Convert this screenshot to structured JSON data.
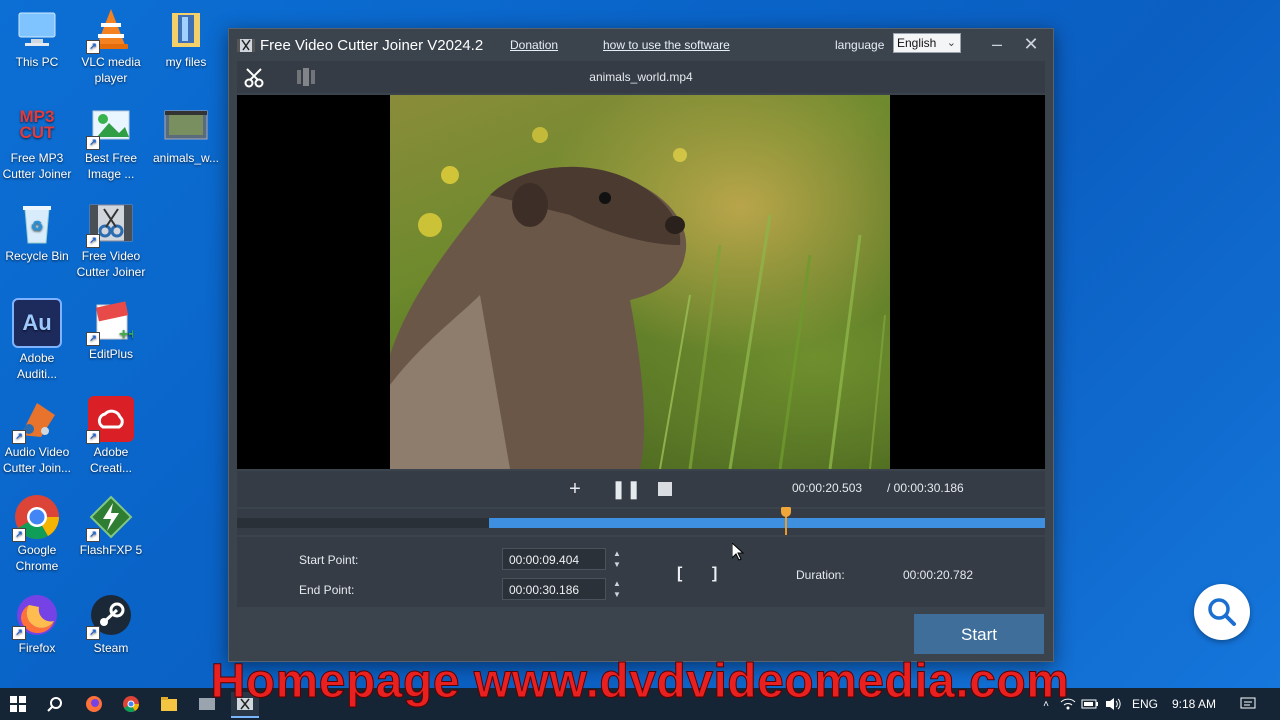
{
  "desktop": {
    "icons": [
      {
        "label": "This PC"
      },
      {
        "label": "VLC media player"
      },
      {
        "label": "my files"
      },
      {
        "label": "Free MP3 Cutter Joiner",
        "glyph": "MP3 CUT"
      },
      {
        "label": "Best Free Image ..."
      },
      {
        "label": "animals_w..."
      },
      {
        "label": "Recycle Bin"
      },
      {
        "label": "Free Video Cutter Joiner"
      },
      {
        "label": "Adobe Auditi...",
        "glyph": "Au"
      },
      {
        "label": "EditPlus"
      },
      {
        "label": "Audio Video Cutter Join..."
      },
      {
        "label": "Adobe Creati..."
      },
      {
        "label": "Google Chrome"
      },
      {
        "label": "FlashFXP 5"
      },
      {
        "label": "Firefox"
      },
      {
        "label": "Steam"
      }
    ]
  },
  "window": {
    "title": "Free Video Cutter Joiner V2024.2",
    "donation_link": "Donation",
    "howto_link": "how to use the software",
    "language_label": "language",
    "language_value": "English",
    "filename": "animals_world.mp4",
    "current_time": "00:00:20.503",
    "total_time": "/ 00:00:30.186",
    "start_point_label": "Start Point:",
    "start_point_value": "00:00:09.404",
    "end_point_label": "End Point:",
    "end_point_value": "00:00:30.186",
    "duration_label": "Duration:",
    "duration_value": "00:00:20.782",
    "start_button": "Start",
    "set_start_bracket": "[",
    "set_end_bracket": "]",
    "playhead_fraction": 0.679,
    "selection_start_fraction": 0.312,
    "selection_end_fraction": 1.0
  },
  "banner": {
    "text": "Homepage www.dvdvideomedia.com"
  },
  "taskbar": {
    "language": "ENG",
    "time": "9:18 AM"
  },
  "colors": {
    "accent_blue": "#3f8fe0",
    "playhead_orange": "#f1a63a",
    "banner_red": "#e8201f"
  }
}
